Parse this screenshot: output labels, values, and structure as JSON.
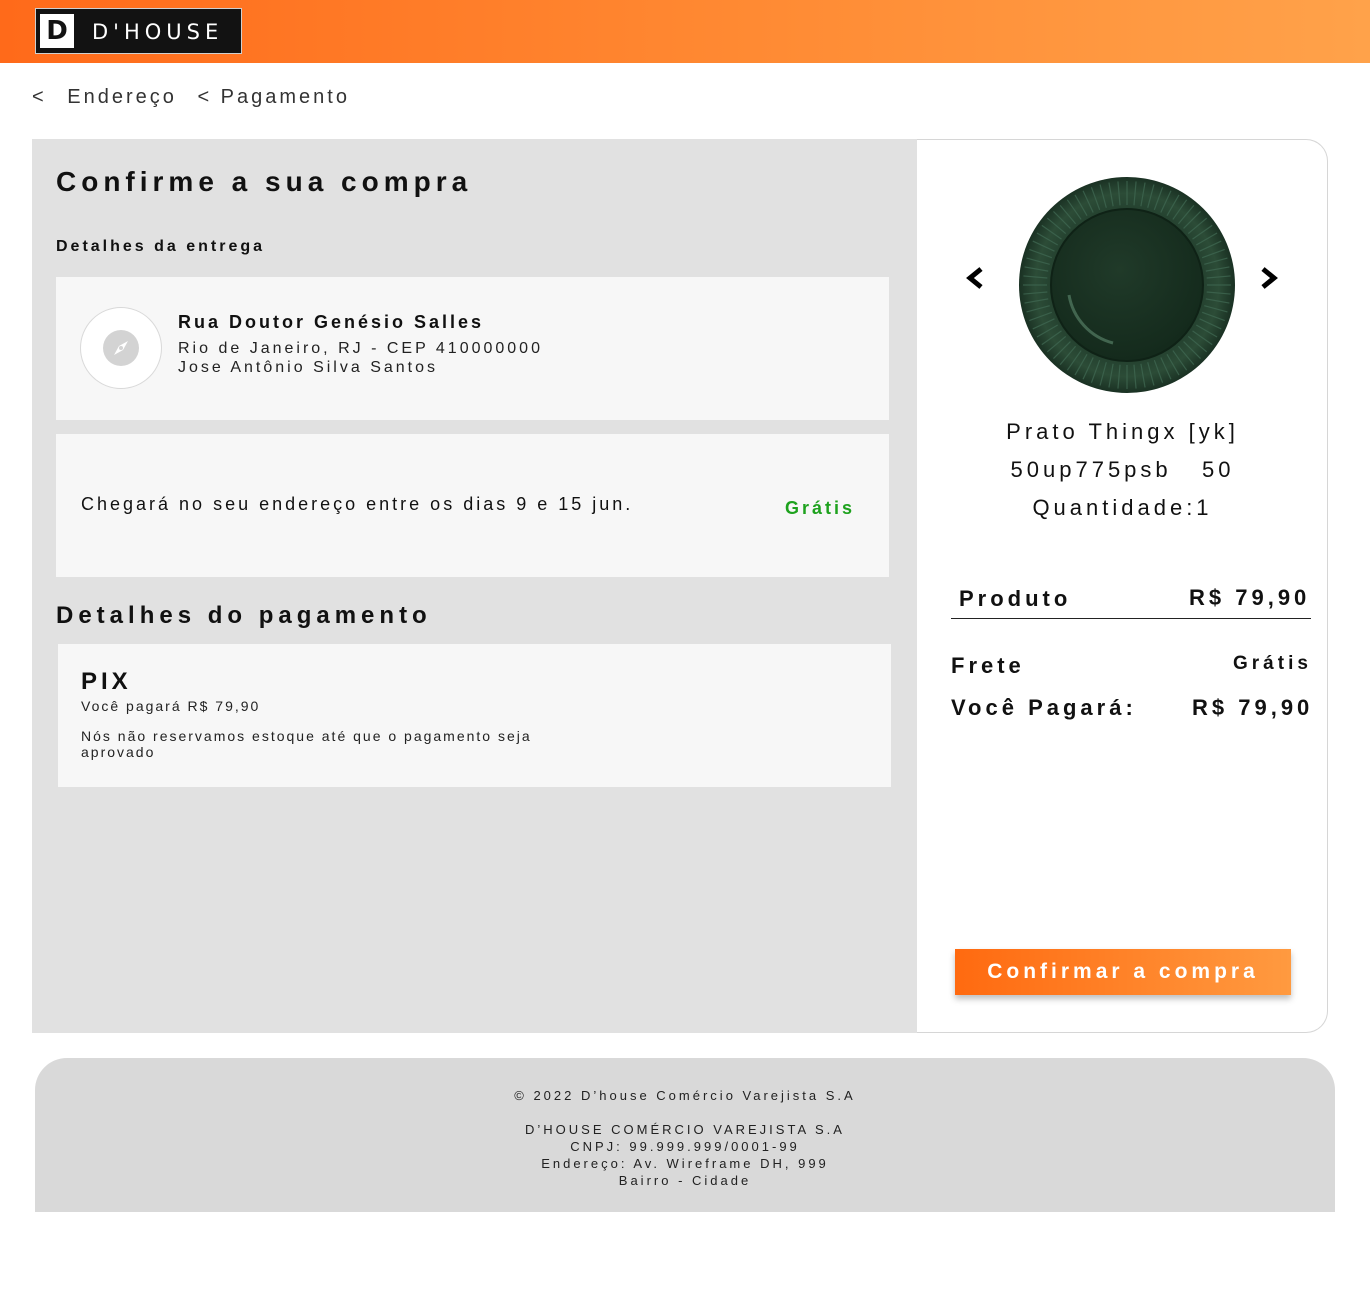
{
  "header": {
    "logo_mark": "D",
    "logo_text": "D'HOUSE",
    "brand_gradient": [
      "#ff6a1a",
      "#ffa24a"
    ]
  },
  "breadcrumb": {
    "back": "<",
    "items": [
      "Endereço",
      "< Pagamento"
    ]
  },
  "main": {
    "title": "Confirme a sua compra",
    "delivery_heading": "Detalhes da entrega",
    "address": {
      "icon": "compass-icon",
      "street": "Rua Doutor Genésio Salles",
      "city_line": "Rio de Janeiro, RJ - CEP 410000000",
      "recipient": "Jose Antônio Silva Santos"
    },
    "shipping": {
      "text": "Chegará no seu endereço entre os dias 9 e 15 jun.",
      "price": "Grátis"
    },
    "payment_heading": "Detalhes do pagamento",
    "payment": {
      "method": "PIX",
      "amount_text": "Você pagará R$ 79,90",
      "note": "Nós não reservamos estoque até que o pagamento seja aprovado"
    }
  },
  "product": {
    "prev_icon": "chevron-left-icon",
    "next_icon": "chevron-right-icon",
    "image": "green-plate-image",
    "name": "Prato Thingx [yk]",
    "code": "50up775psb   50",
    "quantity": "Quantidade:1"
  },
  "summary": {
    "product_label": "Produto",
    "product_value": "R$ 79,90",
    "shipping_label": "Frete",
    "shipping_value": "Grátis",
    "total_label": "Você Pagará:",
    "total_value": "R$ 79,90",
    "free_color": "#1ea21e"
  },
  "actions": {
    "confirm_label": "Confirmar a compra"
  },
  "footer": {
    "copyright": "© 2022 D’house Comércio Varejista S.A",
    "company": "D’HOUSE COMÉRCIO VAREJISTA S.A",
    "cnpj": "CNPJ: 99.999.999/0001-99",
    "address": "Endereço: Av. Wireframe DH, 999",
    "district": "Bairro - Cidade"
  }
}
